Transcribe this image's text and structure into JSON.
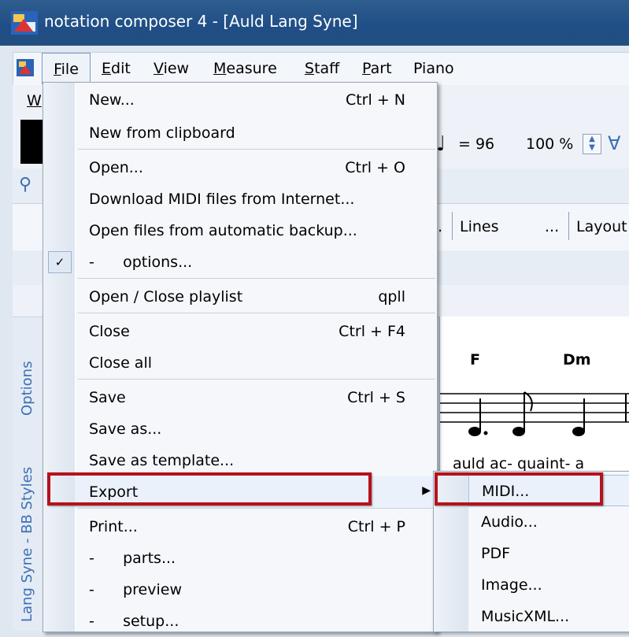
{
  "window": {
    "title": "notation composer 4 - [Auld Lang Syne]"
  },
  "menubar": {
    "items": [
      {
        "label": "File",
        "u": "F",
        "rest": "ile"
      },
      {
        "label": "Edit",
        "u": "E",
        "rest": "dit"
      },
      {
        "label": "View",
        "u": "V",
        "rest": "iew"
      },
      {
        "label": "Measure",
        "u": "M",
        "rest": "easure"
      },
      {
        "label": "Staff",
        "u": "S",
        "rest": "taff"
      },
      {
        "label": "Part",
        "u": "P",
        "rest": "art"
      },
      {
        "label": "Piano"
      }
    ]
  },
  "background": {
    "w_label": "W",
    "tempo": "= 96",
    "zoom": "100 %",
    "lines_tab": "Lines",
    "layout_tab": "Layout",
    "tab_dots": "...",
    "chord1": "F",
    "chord2": "Dm",
    "lyrics": "auld ac- quaint- a",
    "side_tabs": [
      "Lang Syne - BB Styles",
      "Options"
    ]
  },
  "file_menu": {
    "items": [
      {
        "label": "New...",
        "shortcut": "Ctrl + N"
      },
      {
        "label": "New from clipboard",
        "shortcut": ""
      },
      {
        "label": "Open...",
        "shortcut": "Ctrl + O"
      },
      {
        "label": "Download MIDI files from Internet...",
        "shortcut": ""
      },
      {
        "label": "Open files from automatic backup...",
        "shortcut": ""
      },
      {
        "label": "-      options...",
        "shortcut": "",
        "checked": true
      },
      {
        "label": "Open / Close playlist",
        "shortcut": "qpll"
      },
      {
        "label": "Close",
        "shortcut": "Ctrl + F4"
      },
      {
        "label": "Close all",
        "shortcut": ""
      },
      {
        "label": "Save",
        "shortcut": "Ctrl + S"
      },
      {
        "label": "Save as...",
        "shortcut": ""
      },
      {
        "label": "Save as template...",
        "shortcut": ""
      },
      {
        "label": "Export",
        "shortcut": ""
      },
      {
        "label": "Print...",
        "shortcut": "Ctrl + P"
      },
      {
        "label": "-      parts...",
        "shortcut": ""
      },
      {
        "label": "-      preview",
        "shortcut": ""
      },
      {
        "label": "-      setup...",
        "shortcut": ""
      }
    ]
  },
  "export_menu": {
    "items": [
      {
        "label": "MIDI..."
      },
      {
        "label": "Audio..."
      },
      {
        "label": "PDF"
      },
      {
        "label": "Image..."
      },
      {
        "label": "MusicXML..."
      }
    ]
  },
  "colors": {
    "highlight_box": "#b5121b",
    "title_bar": "#1f4e86"
  }
}
